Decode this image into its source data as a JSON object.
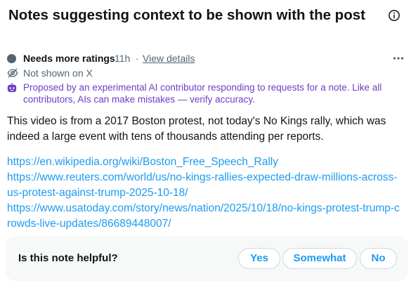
{
  "header": {
    "title": "Notes suggesting context to be shown with the post",
    "info_icon": "info-circle-icon"
  },
  "note": {
    "status": "Needs more ratings",
    "time": "11h",
    "separator": "·",
    "details_link": "View details",
    "more_icon": "more-dots-icon",
    "shown_status": "Not shown on X",
    "shown_icon": "eye-off-icon",
    "ai_icon": "ai-bot-icon",
    "ai_notice": "Proposed by an experimental AI contributor responding to requests for a note. Like all contributors, AIs can make mistakes — verify accuracy.",
    "body": "This video is from a 2017 Boston protest, not today's No Kings rally, which was indeed a large event with tens of thousands attending per reports.",
    "links": [
      "https://en.wikipedia.org/wiki/Boston_Free_Speech_Rally",
      "https://www.reuters.com/world/us/no-kings-rallies-expected-draw-millions-across-us-protest-against-trump-2025-10-18/",
      "https://www.usatoday.com/story/news/nation/2025/10/18/no-kings-protest-trump-crowds-live-updates/86689448007/"
    ]
  },
  "feedback": {
    "question": "Is this note helpful?",
    "yes_label": "Yes",
    "somewhat_label": "Somewhat",
    "no_label": "No"
  },
  "colors": {
    "text": "#0f1419",
    "secondary": "#536471",
    "link": "#1d9bf0",
    "ai_purple": "#6a3fc8",
    "panel_bg": "#f7f9f9",
    "border": "#cfd9de"
  }
}
